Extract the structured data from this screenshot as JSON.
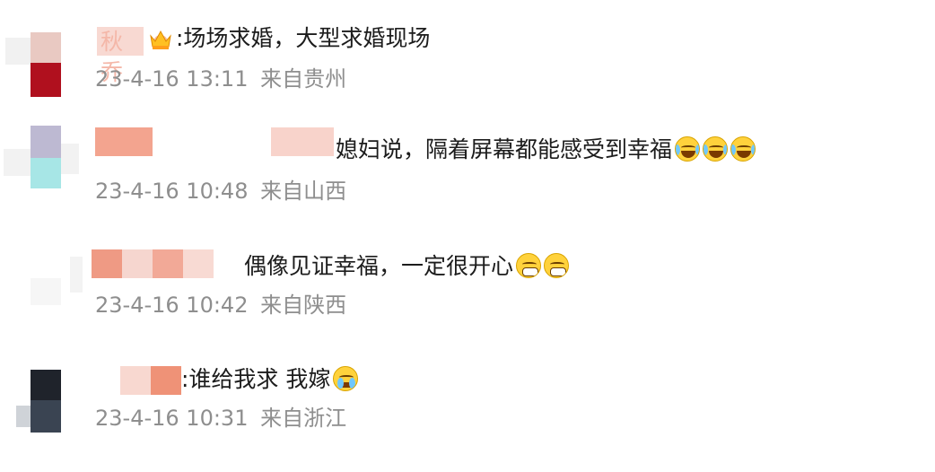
{
  "comments": [
    {
      "user_name_partial": "秋乔",
      "text": ":场场求婚，大型求婚现场",
      "time": "23-4-16 13:11",
      "location": "来自贵州"
    },
    {
      "text": "媳妇说，隔着屏幕都能感受到幸福",
      "time": "23-4-16 10:48",
      "location": "来自山西"
    },
    {
      "text": "偶像见证幸福，一定很开心",
      "time": "23-4-16 10:42",
      "location": "来自陕西"
    },
    {
      "text": ":谁给我求 我嫁",
      "time": "23-4-16 10:31",
      "location": "来自浙江"
    }
  ],
  "icons": {
    "vip_badge": "crown-icon",
    "laugh_cry": "laugh-cry-emoji-icon",
    "grin": "grin-emoji-icon",
    "cry": "cry-emoji-icon"
  },
  "colors": {
    "text": "#1c1c1c",
    "meta": "#8e8e8e",
    "blur_salmon": "#f19a86",
    "blur_pink": "#f7d0c6",
    "avatar_red": "#b0101e"
  }
}
